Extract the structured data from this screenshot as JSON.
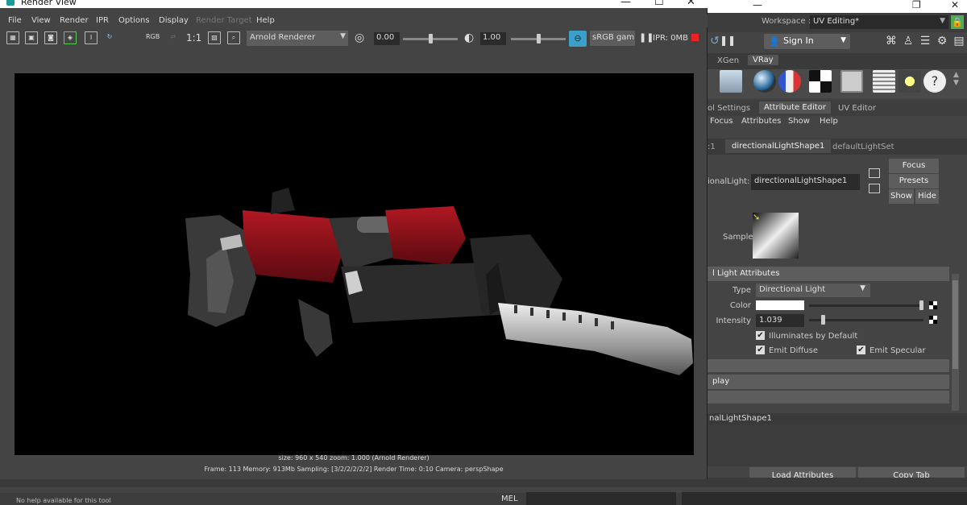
{
  "render_view": {
    "title": "Render View",
    "menus": [
      "File",
      "View",
      "Render",
      "IPR",
      "Options",
      "Display",
      "Render Target",
      "Help"
    ],
    "toolbar": {
      "scale_label": "1:1",
      "rgb_label": "RGB",
      "renderer": "Arnold Renderer",
      "exposure": "0.00",
      "gamma": "1.00",
      "color_space": "sRGB gamm",
      "ipr_memory": "IPR: 0MB"
    },
    "info_line1": "size: 960 x 540  zoom: 1.000      (Arnold Renderer)",
    "info_line2": "Frame: 113     Memory: 913Mb     Sampling: [3/2/2/2/2/2]     Render Time: 0:10     Camera: perspShape"
  },
  "maya": {
    "workspace_label": "Workspace :",
    "workspace_value": "UV Editing*",
    "sign_in": "Sign In",
    "shelf_tabs": [
      "XGen",
      "VRay"
    ],
    "ae_tabs": [
      "ol Settings",
      "Attribute Editor",
      "UV Editor"
    ],
    "ae_menu": [
      "Focus",
      "Attributes",
      "Show",
      "Help"
    ],
    "node_tabs": [
      ":1",
      "directionalLightShape1",
      "defaultLightSet"
    ],
    "light_label": "ionalLight:",
    "light_name": "directionalLightShape1",
    "buttons": {
      "focus": "Focus",
      "presets": "Presets",
      "show": "Show",
      "hide": "Hide"
    },
    "sample_label": "Sample",
    "section_light": "l Light Attributes",
    "type_label": "Type",
    "type_value": "Directional Light",
    "color_label": "Color",
    "intensity_label": "Intensity",
    "intensity_value": "1.039",
    "intensity_level": 0.12,
    "color_level": 1.0,
    "illuminates": "Illuminates by Default",
    "emit_diffuse": "Emit Diffuse",
    "emit_specular": "Emit Specular",
    "section_display": "play",
    "notes_label": "nalLightShape1",
    "load_attributes": "Load Attributes",
    "copy_tab": "Copy Tab",
    "help_line": "No help available for this tool",
    "mel": "MEL"
  }
}
